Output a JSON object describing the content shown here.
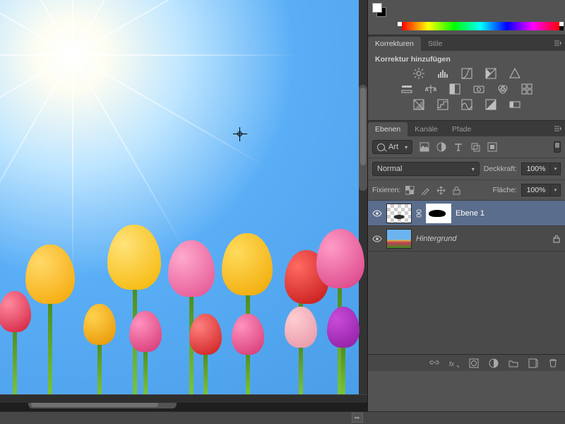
{
  "corrections_panel": {
    "tab_active": "Korrekturen",
    "tab_inactive": "Stile",
    "header": "Korrektur hinzufügen",
    "rows": [
      [
        "brightness",
        "levels",
        "curves",
        "exposure",
        "vibrance"
      ],
      [
        "hue",
        "balance",
        "bw",
        "photo-filter",
        "channel-mixer",
        "color-lookup"
      ],
      [
        "invert",
        "posterize",
        "threshold",
        "selective-color",
        "gradient-map"
      ]
    ]
  },
  "layers_panel": {
    "tabs": {
      "active": "Ebenen",
      "other": [
        "Kanäle",
        "Pfade"
      ]
    },
    "filter_kind": "Art",
    "blend_mode": "Normal",
    "opacity": {
      "label": "Deckkraft:",
      "value": "100%"
    },
    "lock": {
      "label": "Fixieren:"
    },
    "fill": {
      "label": "Fläche:",
      "value": "100%"
    },
    "layers": [
      {
        "name": "Ebene 1",
        "visible": true,
        "selected": true,
        "has_mask": true,
        "thumb": "transparent",
        "italic": false,
        "locked": false
      },
      {
        "name": "Hintergrund",
        "visible": true,
        "selected": false,
        "has_mask": false,
        "thumb": "background",
        "italic": true,
        "locked": true
      }
    ],
    "footer_icons": [
      "link",
      "fx",
      "mask",
      "adjustment",
      "group",
      "new",
      "trash"
    ]
  }
}
